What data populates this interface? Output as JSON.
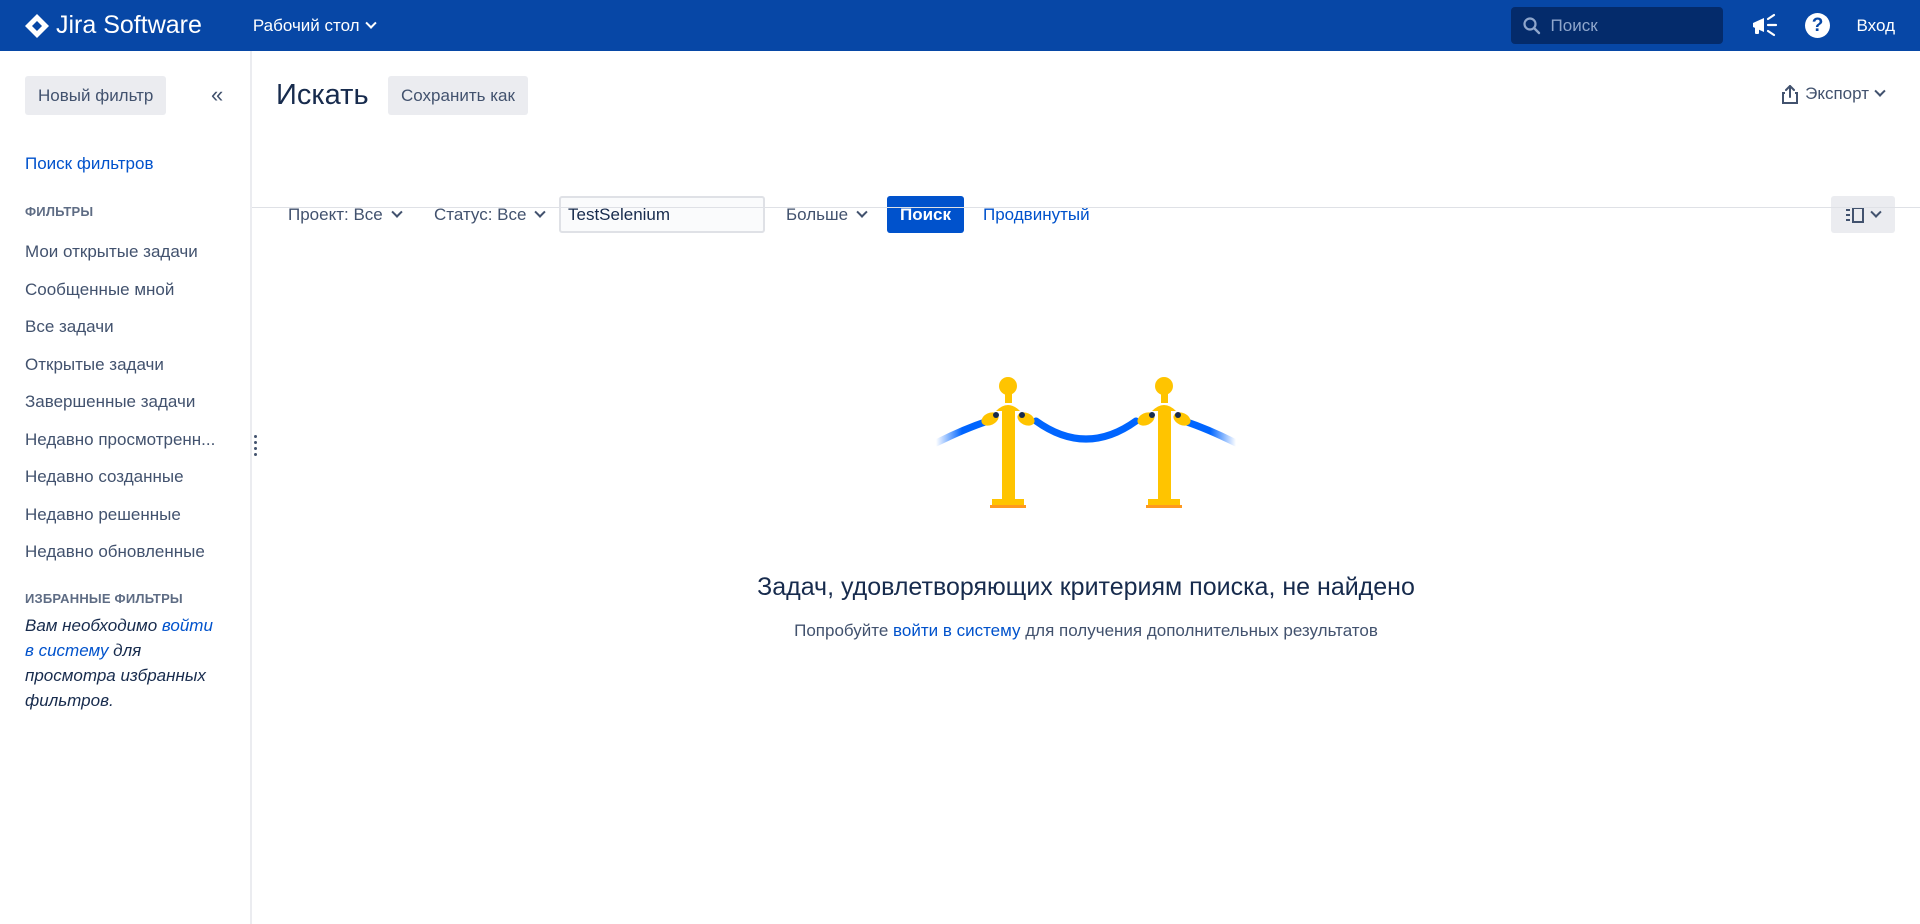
{
  "topbar": {
    "product": "Jira Software",
    "workspace": "Рабочий стол",
    "search_placeholder": "Поиск",
    "login": "Вход"
  },
  "sidebar": {
    "new_filter": "Новый фильтр",
    "find_filters": "Поиск фильтров",
    "filters_heading": "ФИЛЬТРЫ",
    "filters": [
      "Мои открытые задачи",
      "Сообщенные мной",
      "Все задачи",
      "Открытые задачи",
      "Завершенные задачи",
      "Недавно просмотренн...",
      "Недавно созданные",
      "Недавно решенные",
      "Недавно обновленные"
    ],
    "favorites_heading": "ИЗБРАННЫЕ ФИЛЬТРЫ",
    "favorites_note_prefix": "Вам необходимо ",
    "favorites_note_link": "войти в систему",
    "favorites_note_suffix": " для просмотра избранных фильтров."
  },
  "main": {
    "title": "Искать",
    "save_as": "Сохранить как",
    "export": "Экспорт",
    "project_filter": "Проект: Все",
    "status_filter": "Статус: Все",
    "text_query": "TestSelenium",
    "more": "Больше",
    "search_button": "Поиск",
    "advanced": "Продвинутый"
  },
  "empty_state": {
    "title": "Задач, удовлетворяющих критериям поиска, не найдено",
    "sub_prefix": "Попробуйте ",
    "sub_link": "войти в систему",
    "sub_suffix": " для получения дополнительных результатов"
  },
  "colors": {
    "brand": "#0747a6",
    "link": "#0052cc",
    "post": "#ffc400",
    "rope": "#0065ff"
  }
}
